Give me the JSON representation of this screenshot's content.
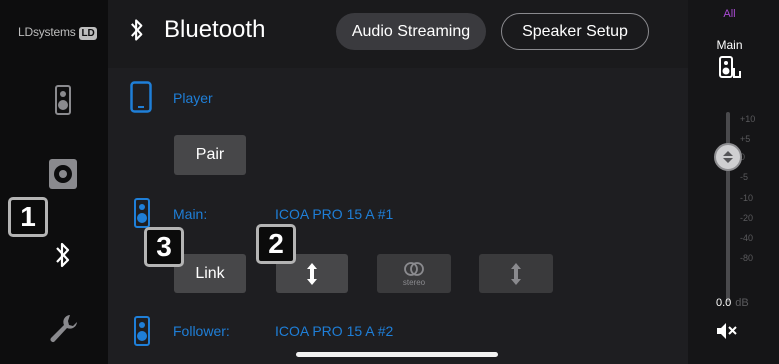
{
  "brand": {
    "name": "LDsystems",
    "logo": "LD"
  },
  "sidebar": {
    "items": [
      {
        "name": "speaker",
        "icon": "speaker-icon"
      },
      {
        "name": "subwoofer",
        "icon": "subwoofer-icon"
      },
      {
        "name": "bluetooth",
        "icon": "bluetooth-icon"
      },
      {
        "name": "settings",
        "icon": "wrench-icon"
      }
    ]
  },
  "header": {
    "title": "Bluetooth",
    "tabs": [
      {
        "label": "Audio Streaming",
        "active": true
      },
      {
        "label": "Speaker Setup",
        "active": false
      }
    ]
  },
  "player": {
    "label": "Player",
    "pair_label": "Pair"
  },
  "main_speaker": {
    "label": "Main:",
    "device": "ICOA PRO 15 A #1"
  },
  "link": {
    "label": "Link",
    "stereo_label": "stereo"
  },
  "follower": {
    "label": "Follower:",
    "device": "ICOA PRO 15 A #2"
  },
  "badges": {
    "one": "1",
    "two": "2",
    "three": "3"
  },
  "right_panel": {
    "all_label": "All",
    "main_label": "Main",
    "scale": [
      "+10",
      "+5",
      "0",
      "-5",
      "-10",
      "-20",
      "-40",
      "-80"
    ],
    "level_value": "0.0",
    "level_unit": "dB"
  },
  "colors": {
    "accent_blue": "#1f7fd8",
    "accent_purple": "#a94bd4"
  }
}
